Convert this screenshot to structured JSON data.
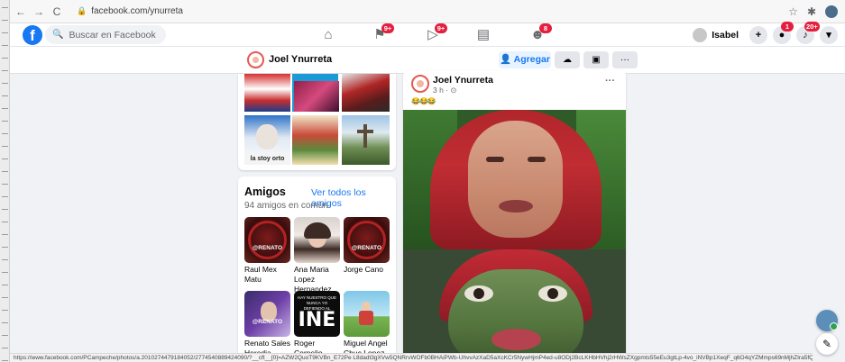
{
  "browser": {
    "url": "facebook.com/ynurreta",
    "lock_icon": "lock-icon",
    "back": "←",
    "forward": "→",
    "reload": "C",
    "star": "☆",
    "puzzle": "✱"
  },
  "fb_nav": {
    "logo": "f",
    "search_placeholder": "Buscar en Facebook",
    "icons": [
      {
        "name": "home-icon",
        "glyph": "⌂",
        "badge": ""
      },
      {
        "name": "pages-flag-icon",
        "glyph": "⚑",
        "badge": "9+"
      },
      {
        "name": "watch-icon",
        "glyph": "▷",
        "badge": "9+"
      },
      {
        "name": "marketplace-icon",
        "glyph": "▤",
        "badge": ""
      },
      {
        "name": "groups-icon",
        "glyph": "☻",
        "badge": "8"
      }
    ],
    "user_name": "Isabel",
    "create_glyph": "+",
    "messenger_badge": "1",
    "notifications_badge": "20+",
    "menu_glyph": "▾"
  },
  "profile_bar": {
    "name": "Joel Ynurreta",
    "add_label": "Agregar",
    "messenger_glyph": "☁",
    "extra_glyph": "▣",
    "more_glyph": "···"
  },
  "photos": {
    "caption": "la stoy orto"
  },
  "friends": {
    "title": "Amigos",
    "see_all": "Ver todos los amigos",
    "common_count": "94 amigos en común",
    "list": [
      {
        "name": "Raul Mex Matu",
        "tag": "@RENATO"
      },
      {
        "name": "Ana Maria Lopez Hernandez",
        "tag": ""
      },
      {
        "name": "Jorge Cano",
        "tag": "@RENATO"
      },
      {
        "name": "Renato Sales Heredia",
        "tag": "@RENATO"
      },
      {
        "name": "Roger Cornelio",
        "tag": "INE"
      },
      {
        "name": "Miguel Angel Chuc Lopez",
        "tag": ""
      }
    ],
    "ine_caption": "HAY NUESTRO QUE NUNCA YO DEFIENDO AL"
  },
  "post": {
    "author": "Joel Ynurreta",
    "time": "3 h · ⊙",
    "emoji": "😂😂😂",
    "more_glyph": "···"
  },
  "status_url": "https://www.facebook.com/PCampeche/photos/a.2010274479184052/2774540889424090/?__cft__[0]=AZW2QuoT9KVBn_E72Pe L8dadt3gXVw5QNRrvWOFb0BHAiPWb-UhvvAzXaD5aXcKCr5NywHjmP4ed-u8ODj2BcLKHbHVhj2rHWsZXgpmts55eEu3gtLp-4vo_iNVBp1XeqF_q6O4qYZMmps69nMjhZIra5fQQp7h1u1KVwPFjqqcA&__tn__=EH-y-R",
  "colors": {
    "brand": "#1877f2",
    "badge": "#e41e3f",
    "page_bg": "#f0f2f5"
  }
}
